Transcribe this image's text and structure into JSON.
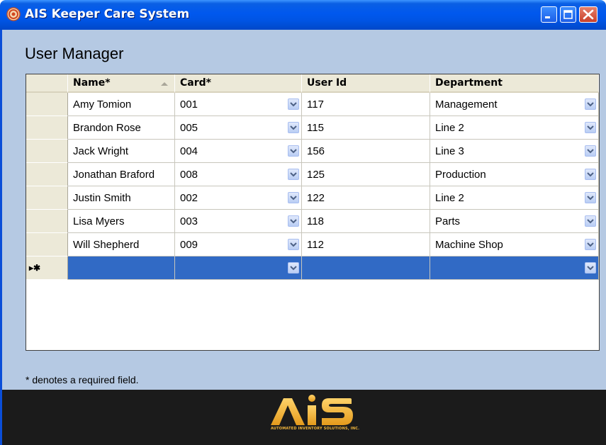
{
  "window": {
    "title": "AIS Keeper Care System",
    "icons": {
      "app": "target-icon",
      "minimize": "minimize-icon",
      "maximize": "maximize-icon",
      "close": "close-icon"
    }
  },
  "page": {
    "title": "User Manager"
  },
  "grid": {
    "columns": [
      {
        "label": "Name*",
        "sort": "ascending"
      },
      {
        "label": "Card*"
      },
      {
        "label": "User Id"
      },
      {
        "label": "Department"
      }
    ],
    "rows": [
      {
        "name": "Amy Tomion",
        "card": "001",
        "user_id": "117",
        "department": "Management"
      },
      {
        "name": "Brandon Rose",
        "card": "005",
        "user_id": "115",
        "department": "Line 2"
      },
      {
        "name": "Jack Wright",
        "card": "004",
        "user_id": "156",
        "department": "Line 3"
      },
      {
        "name": "Jonathan Braford",
        "card": "008",
        "user_id": "125",
        "department": "Production"
      },
      {
        "name": "Justin Smith",
        "card": "002",
        "user_id": "122",
        "department": "Line 2"
      },
      {
        "name": "Lisa Myers",
        "card": "003",
        "user_id": "118",
        "department": "Parts"
      },
      {
        "name": "Will Shepherd",
        "card": "009",
        "user_id": "112",
        "department": "Machine Shop"
      }
    ],
    "new_row_marker": "▸✱"
  },
  "footnote": "* denotes a required field.",
  "branding": {
    "logo_text": "AiS",
    "tagline": "AUTOMATED INVENTORY SOLUTIONS, INC.",
    "colors": {
      "gold": "#f2b63c",
      "dark": "#1b1b1b"
    }
  },
  "colors": {
    "titlebar": "#0054e3",
    "client_bg": "#b5c9e3",
    "selected_row": "#316ac5",
    "header_bg": "#ece9d8"
  }
}
